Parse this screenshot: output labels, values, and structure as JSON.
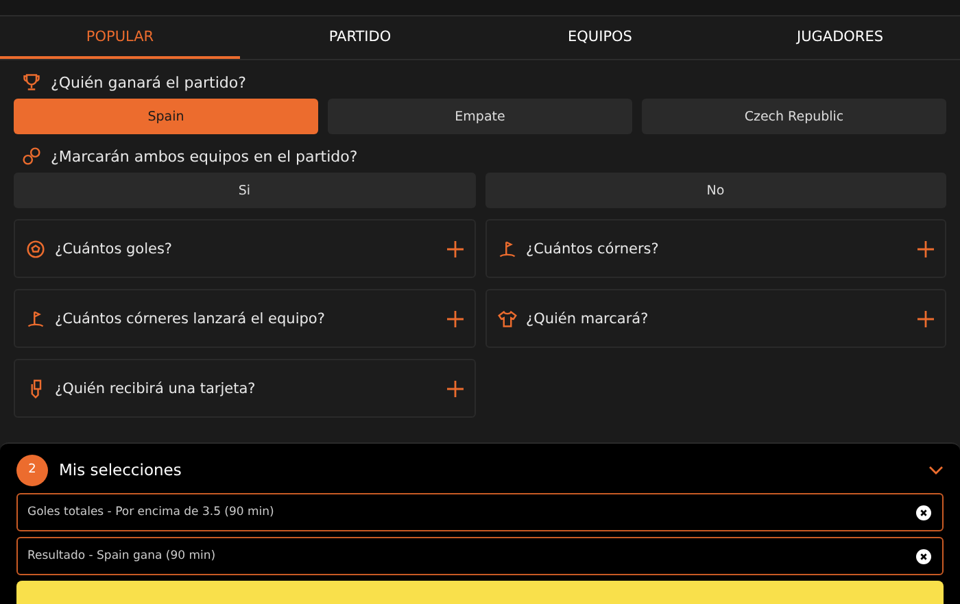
{
  "tabs": [
    {
      "label": "POPULAR",
      "selected": true
    },
    {
      "label": "PARTIDO",
      "selected": false
    },
    {
      "label": "EQUIPOS",
      "selected": false
    },
    {
      "label": "JUGADORES",
      "selected": false
    }
  ],
  "questions": [
    {
      "kind": "trophy",
      "title": "¿Quién ganará el partido?",
      "options": [
        {
          "label": "Spain",
          "selected": true
        },
        {
          "label": "Empate",
          "selected": false
        },
        {
          "label": "Czech Republic",
          "selected": false
        }
      ]
    },
    {
      "kind": "balls",
      "title": "¿Marcarán ambos equipos en el partido?",
      "options": [
        {
          "label": "Si",
          "selected": false
        },
        {
          "label": "No",
          "selected": false
        }
      ]
    }
  ],
  "markets": [
    {
      "kind": "ball",
      "title": "¿Cuántos goles?"
    },
    {
      "kind": "flag",
      "title": "¿Cuántos córners?"
    },
    {
      "kind": "flag",
      "title": "¿Cuántos córneres lanzará el equipo?"
    },
    {
      "kind": "shirt",
      "title": "¿Quién marcará?"
    },
    {
      "kind": "card",
      "title": "¿Quién recibirá una tarjeta?"
    }
  ],
  "selections": {
    "count": "2",
    "title": "Mis selecciones",
    "items": [
      "Goles totales - Por encima de 3.5 (90 min)",
      "Resultado - Spain gana (90 min)"
    ]
  }
}
